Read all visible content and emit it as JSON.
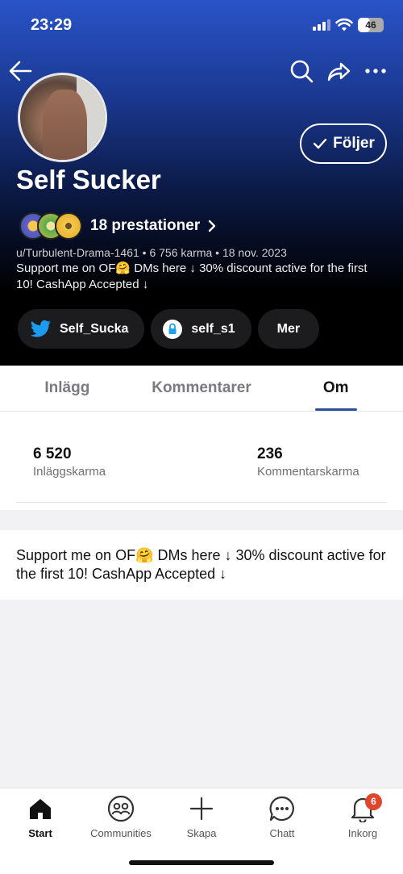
{
  "status_bar": {
    "time": "23:29",
    "battery": "46",
    "battery_level": 0.46
  },
  "profile": {
    "display_name": "Self Sucker",
    "follow_label": "Följer",
    "achievements_label": "18 prestationer",
    "meta": "u/Turbulent-Drama-1461 • 6 756 karma • 18 nov. 2023",
    "bio": "Support me on OF🤗 DMs here ↓ 30% discount active for the first 10! CashApp Accepted  ↓"
  },
  "social_links": [
    {
      "label": "Self_Sucka",
      "icon": "twitter-icon"
    },
    {
      "label": "self_s1",
      "icon": "onlyfans-lock-icon"
    },
    {
      "label": "Mer"
    }
  ],
  "tabs": [
    {
      "label": "Inlägg"
    },
    {
      "label": "Kommentarer"
    },
    {
      "label": "Om",
      "active": true
    }
  ],
  "karma": {
    "post": {
      "value": "6 520",
      "label": "Inläggskarma"
    },
    "comment": {
      "value": "236",
      "label": "Kommentarskarma"
    }
  },
  "about": {
    "text": "Support me on OF🤗 DMs here ↓ 30% discount active for the first 10! CashApp Accepted  ↓"
  },
  "bottom_nav": [
    {
      "label": "Start",
      "icon": "home-icon",
      "active": true
    },
    {
      "label": "Communities",
      "icon": "communities-icon"
    },
    {
      "label": "Skapa",
      "icon": "plus-icon"
    },
    {
      "label": "Chatt",
      "icon": "chat-icon"
    },
    {
      "label": "Inkorg",
      "icon": "bell-icon",
      "badge": "6"
    }
  ],
  "colors": {
    "accent": "#2c4e9f",
    "badge": "#e0462b",
    "header_top": "#2a53c8",
    "chip_bg": "#1c1c1e"
  }
}
